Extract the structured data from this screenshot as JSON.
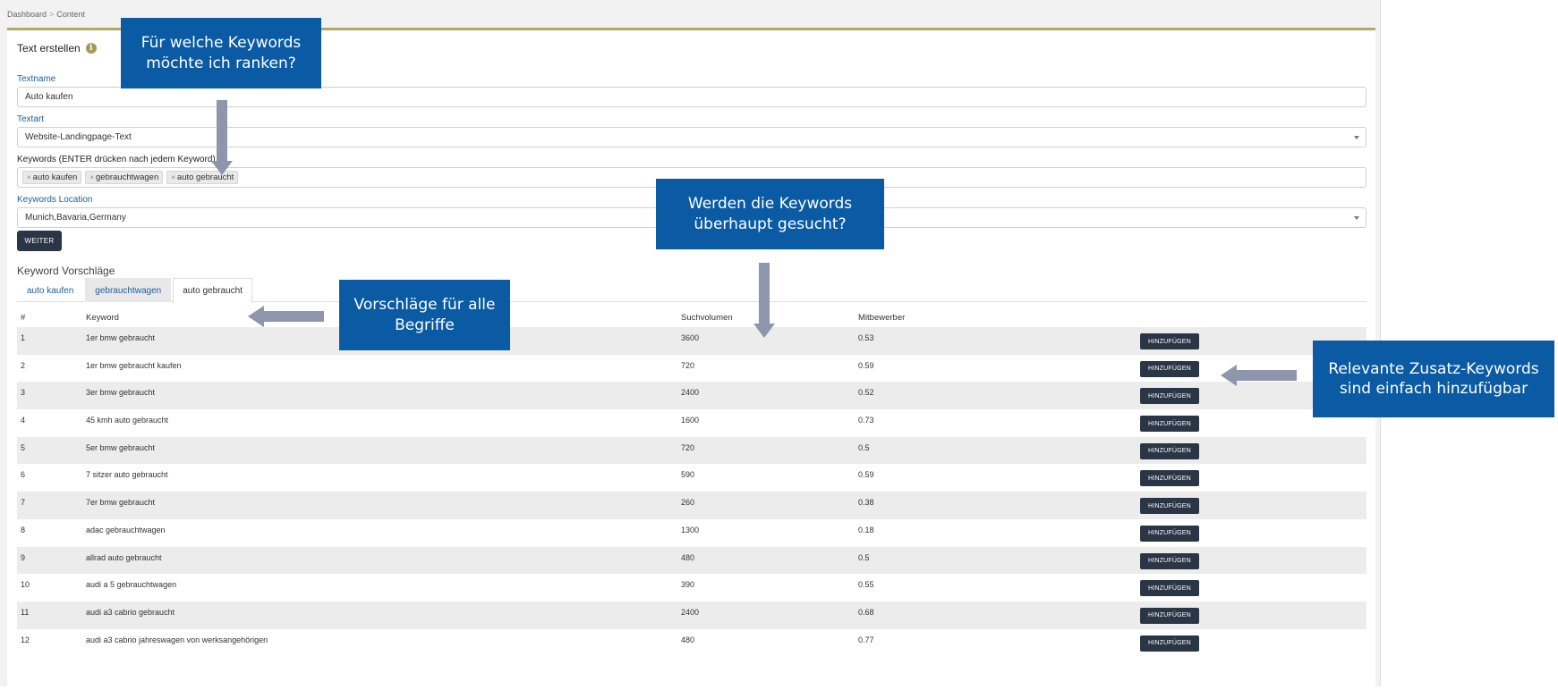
{
  "breadcrumb": {
    "home": "Dashboard",
    "separator": ">",
    "current": "Content"
  },
  "card": {
    "title": "Text erstellen",
    "info_icon": "info-icon"
  },
  "form": {
    "textname_label": "Textname",
    "textname_value": "Auto kaufen",
    "textart_label": "Textart",
    "textart_value": "Website-Landingpage-Text",
    "keywords_label": "Keywords (ENTER drücken nach jedem Keyword)",
    "keywords": [
      "auto kaufen",
      "gebrauchtwagen",
      "auto gebraucht"
    ],
    "location_label": "Keywords Location",
    "location_value": "Munich,Bavaria,Germany",
    "weiter_label": "WEITER"
  },
  "suggestions": {
    "title": "Keyword Vorschläge",
    "tabs": [
      {
        "label": "auto kaufen",
        "state": "normal"
      },
      {
        "label": "gebrauchtwagen",
        "state": "shaded"
      },
      {
        "label": "auto gebraucht",
        "state": "active"
      }
    ],
    "columns": {
      "num": "#",
      "keyword": "Keyword",
      "volume": "Suchvolumen",
      "competition": "Mitbewerber"
    },
    "add_label": "HINZUFÜGEN",
    "rows": [
      {
        "num": "1",
        "keyword": "1er bmw gebraucht",
        "volume": "3600",
        "competition": "0.53"
      },
      {
        "num": "2",
        "keyword": "1er bmw gebraucht kaufen",
        "volume": "720",
        "competition": "0.59"
      },
      {
        "num": "3",
        "keyword": "3er bmw gebraucht",
        "volume": "2400",
        "competition": "0.52"
      },
      {
        "num": "4",
        "keyword": "45 kmh auto gebraucht",
        "volume": "1600",
        "competition": "0.73"
      },
      {
        "num": "5",
        "keyword": "5er bmw gebraucht",
        "volume": "720",
        "competition": "0.5"
      },
      {
        "num": "6",
        "keyword": "7 sitzer auto gebraucht",
        "volume": "590",
        "competition": "0.59"
      },
      {
        "num": "7",
        "keyword": "7er bmw gebraucht",
        "volume": "260",
        "competition": "0.38"
      },
      {
        "num": "8",
        "keyword": "adac gebrauchtwagen",
        "volume": "1300",
        "competition": "0.18"
      },
      {
        "num": "9",
        "keyword": "allrad auto gebraucht",
        "volume": "480",
        "competition": "0.5"
      },
      {
        "num": "10",
        "keyword": "audi a 5 gebrauchtwagen",
        "volume": "390",
        "competition": "0.55"
      },
      {
        "num": "11",
        "keyword": "audi a3 cabrio gebraucht",
        "volume": "2400",
        "competition": "0.68"
      },
      {
        "num": "12",
        "keyword": "audi a3 cabrio jahreswagen von werksangehörigen",
        "volume": "480",
        "competition": "0.77"
      }
    ]
  },
  "callouts": {
    "keywords": "Für welche Keywords möchte ich ranken?",
    "volume": "Werden die Keywords überhaupt gesucht?",
    "suggestions": "Vorschläge für alle Begriffe",
    "add": "Relevante Zusatz-Keywords sind einfach hinzufügbar"
  },
  "colors": {
    "callout_bg": "#0a5ba4",
    "arrow": "#8e96ad",
    "button_dark": "#2a3545",
    "accent_line": "#b3a76b",
    "link_blue": "#1f5f99"
  }
}
